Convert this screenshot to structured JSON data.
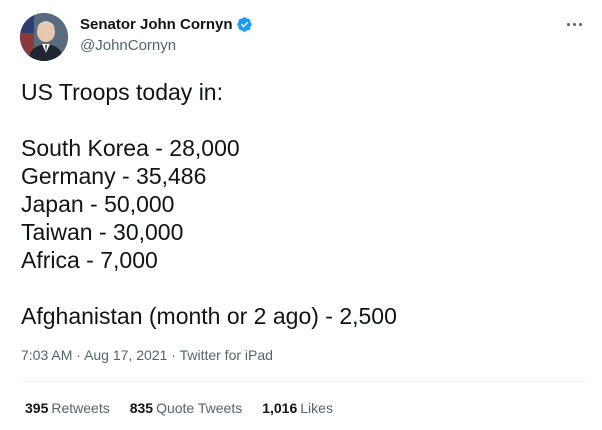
{
  "author": {
    "display_name": "Senator John Cornyn",
    "handle": "@JohnCornyn",
    "verified": true,
    "verified_color": "#1d9bf0"
  },
  "tweet": {
    "lines": [
      "US Troops today in:",
      "",
      "South Korea - 28,000",
      "Germany - 35,486",
      "Japan - 50,000",
      "Taiwan - 30,000",
      "Africa - 7,000",
      "",
      "Afghanistan (month or 2 ago) - 2,500"
    ],
    "time": "7:03 AM",
    "separator": "·",
    "date": "Aug 17, 2021",
    "source": "Twitter for iPad"
  },
  "stats": {
    "retweets_count": "395",
    "retweets_label": "Retweets",
    "quotes_count": "835",
    "quotes_label": "Quote Tweets",
    "likes_count": "1,016",
    "likes_label": "Likes"
  },
  "icons": {
    "more": "more-options-icon",
    "verified": "verified-badge-icon"
  }
}
